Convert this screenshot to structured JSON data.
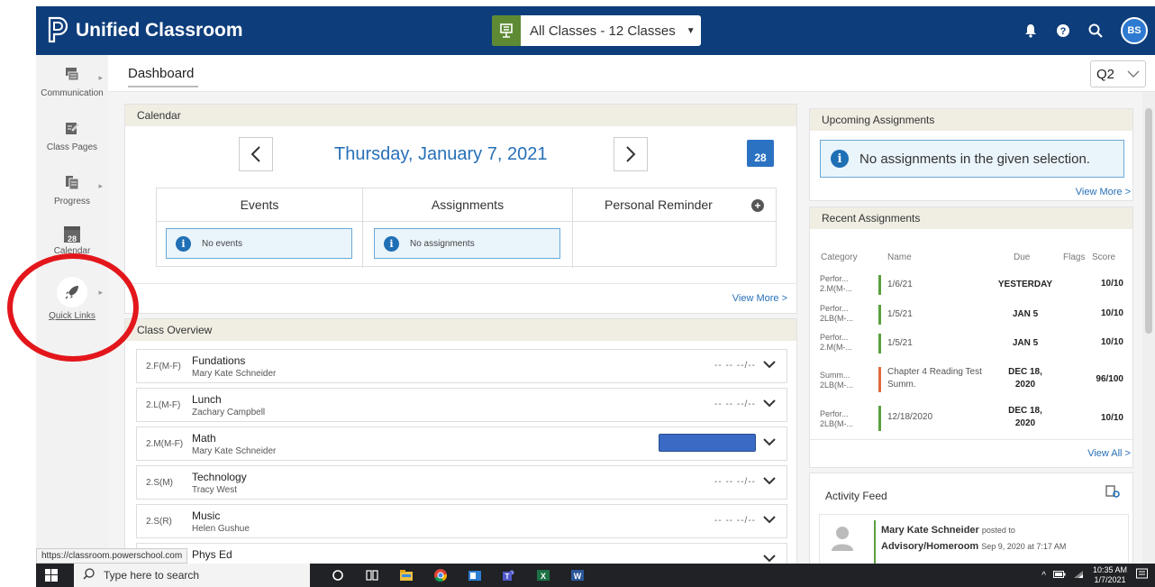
{
  "app": {
    "title": "Unified Classroom",
    "user_initials": "BS"
  },
  "class_selector": {
    "value": "All Classes - 12 Classes"
  },
  "header": {
    "title": "Dashboard",
    "term": "Q2"
  },
  "sidebar": {
    "items": [
      {
        "label": "Communication"
      },
      {
        "label": "Class Pages"
      },
      {
        "label": "Progress"
      },
      {
        "label": "Calendar",
        "icon_text": "28"
      },
      {
        "label": "Quick Links"
      }
    ]
  },
  "calendar": {
    "title": "Calendar",
    "date": "Thursday, January 7, 2021",
    "icon_day": "28",
    "columns": [
      "Events",
      "Assignments",
      "Personal Reminder"
    ],
    "events_empty": "No events",
    "assignments_empty": "No assignments",
    "view_more": "View More >"
  },
  "class_overview": {
    "title": "Class Overview",
    "classes": [
      {
        "code": "2.F(M-F)",
        "name": "Fundations",
        "teacher": "Mary Kate Schneider",
        "grade": "-- -- --/--"
      },
      {
        "code": "2.L(M-F)",
        "name": "Lunch",
        "teacher": "Zachary Campbell",
        "grade": "-- -- --/--"
      },
      {
        "code": "2.M(M-F)",
        "name": "Math",
        "teacher": "Mary Kate Schneider",
        "grade": ""
      },
      {
        "code": "2.S(M)",
        "name": "Technology",
        "teacher": "Tracy West",
        "grade": "-- -- --/--"
      },
      {
        "code": "2.S(R)",
        "name": "Music",
        "teacher": "Helen Gushue",
        "grade": "-- -- --/--"
      },
      {
        "code": "",
        "name": "Phys Ed",
        "teacher": "",
        "grade": ""
      }
    ]
  },
  "upcoming": {
    "title": "Upcoming Assignments",
    "message": "No assignments in the given selection.",
    "view_more": "View More >"
  },
  "recent": {
    "title": "Recent Assignments",
    "headers": {
      "category": "Category",
      "name": "Name",
      "due": "Due",
      "flags": "Flags",
      "score": "Score"
    },
    "rows": [
      {
        "cat1": "Perfor...",
        "cat2": "2.M(M-...",
        "name1": "1/6/21",
        "name2": "",
        "due1": "YESTERDAY",
        "due2": "",
        "score": "10/10",
        "color": "#5aa040"
      },
      {
        "cat1": "Perfor...",
        "cat2": "2LB(M-...",
        "name1": "1/5/21",
        "name2": "",
        "due1": "JAN 5",
        "due2": "",
        "score": "10/10",
        "color": "#5aa040"
      },
      {
        "cat1": "Perfor...",
        "cat2": "2.M(M-...",
        "name1": "1/5/21",
        "name2": "",
        "due1": "JAN 5",
        "due2": "",
        "score": "10/10",
        "color": "#5aa040"
      },
      {
        "cat1": "Summ...",
        "cat2": "2LB(M-...",
        "name1": "Chapter 4 Reading Test",
        "name2": "Summ.",
        "due1": "DEC 18,",
        "due2": "2020",
        "score": "96/100",
        "color": "#e06b3c"
      },
      {
        "cat1": "Perfor...",
        "cat2": "2LB(M-...",
        "name1": "12/18/2020",
        "name2": "",
        "due1": "DEC 18,",
        "due2": "2020",
        "score": "10/10",
        "color": "#5aa040"
      }
    ],
    "view_all": "View All >"
  },
  "activity": {
    "title": "Activity Feed",
    "post": {
      "author": "Mary Kate Schneider",
      "verb": "posted to",
      "target": "Advisory/Homeroom",
      "time": "Sep 9, 2020 at 7:17 AM"
    }
  },
  "status_url": "https://classroom.powerschool.com",
  "taskbar": {
    "search_placeholder": "Type here to search",
    "time": "10:35 AM",
    "date": "1/7/2021"
  },
  "colors": {
    "topbar": "#0d3d7a",
    "accent_blue": "#2770b8",
    "selector_green": "#5e8a34",
    "annotation_red": "#e3161b"
  }
}
